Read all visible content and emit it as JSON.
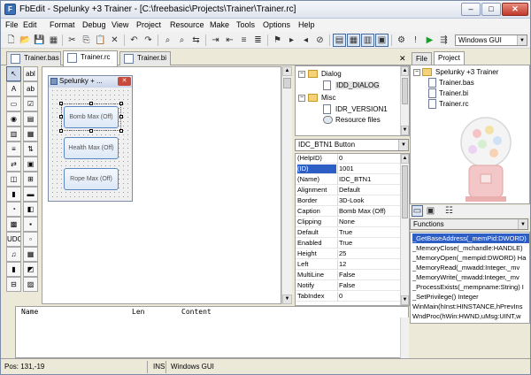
{
  "window": {
    "title": "FbEdit - Spelunky +3 Trainer - [C:\\freebasic\\Projects\\Trainer\\Trainer.rc]",
    "minimize": "–",
    "maximize": "□",
    "close": "✕"
  },
  "menu": [
    "File",
    "Edit",
    "Format",
    "Debug",
    "View",
    "Project",
    "Resource",
    "Make",
    "Tools",
    "Options",
    "Help"
  ],
  "toolbar": {
    "build_combo": "Windows GUI"
  },
  "file_tabs": [
    {
      "label": "Trainer.bas",
      "active": false
    },
    {
      "label": "Trainer.rc",
      "active": true
    },
    {
      "label": "Trainer.bi",
      "active": false
    }
  ],
  "toolbox": [
    "↖",
    "abl",
    "A",
    "ab",
    "▭",
    "☑",
    "◉",
    "▤",
    "▥",
    "▦",
    "≡",
    "⇅",
    "⇄",
    "▣",
    "◫",
    "⊞",
    "▮",
    "▬",
    "◔",
    "◧",
    "▩",
    "▪",
    "UDC",
    "▫",
    "♫",
    "▦",
    "▮",
    "◩",
    "⊟",
    "▨"
  ],
  "dialog": {
    "title": "Spelunky + ...",
    "buttons": [
      "Bomb Max (Off)",
      "Health Max (Off)",
      "Rope Max (Off)"
    ]
  },
  "resource_tree": {
    "folders": [
      {
        "label": "Dialog",
        "items": [
          "IDD_DIALOG"
        ]
      },
      {
        "label": "Misc",
        "items": [
          "IDR_VERSION1",
          "Resource files"
        ]
      }
    ]
  },
  "properties": {
    "selector": "IDC_BTN1 Button",
    "rows": [
      {
        "name": "(HelpID)",
        "value": "0"
      },
      {
        "name": "(ID)",
        "value": "1001"
      },
      {
        "name": "(Name)",
        "value": "IDC_BTN1"
      },
      {
        "name": "Alignment",
        "value": "Default"
      },
      {
        "name": "Border",
        "value": "3D-Look"
      },
      {
        "name": "Caption",
        "value": "Bomb Max (Off)"
      },
      {
        "name": "Clipping",
        "value": "None"
      },
      {
        "name": "Default",
        "value": "True"
      },
      {
        "name": "Enabled",
        "value": "True"
      },
      {
        "name": "Height",
        "value": "25"
      },
      {
        "name": "Left",
        "value": "12"
      },
      {
        "name": "MultiLine",
        "value": "False"
      },
      {
        "name": "Notify",
        "value": "False"
      },
      {
        "name": "TabIndex",
        "value": "0"
      }
    ]
  },
  "right_tabs": [
    "File",
    "Project"
  ],
  "project_tree": {
    "root": "Spelunky +3 Trainer",
    "files": [
      "Trainer.bas",
      "Trainer.bi",
      "Trainer.rc"
    ]
  },
  "functions": {
    "selector": "Functions",
    "items": [
      "_GetBaseAddress(_memPid:DWORD)",
      "_MemoryClose(_mchandle:HANDLE)",
      "_MemoryOpen(_mempid:DWORD) Ha",
      "_MemoryRead(_mwadd:Integer,_mv",
      "_MemoryWrite(_mwadd:Integer,_mv",
      "_ProcessExists(_mempname:String) I",
      "_SetPrivilege() Integer",
      "WinMain(hInst:HINSTANCE,hPrevIns",
      "WndProc(hWin:HWND,uMsg:UINT,w"
    ]
  },
  "output": {
    "columns": [
      "Name",
      "Len",
      "Content"
    ]
  },
  "status": {
    "position": "Pos: 131,-19",
    "mode": "INS",
    "build": "Windows GUI"
  }
}
